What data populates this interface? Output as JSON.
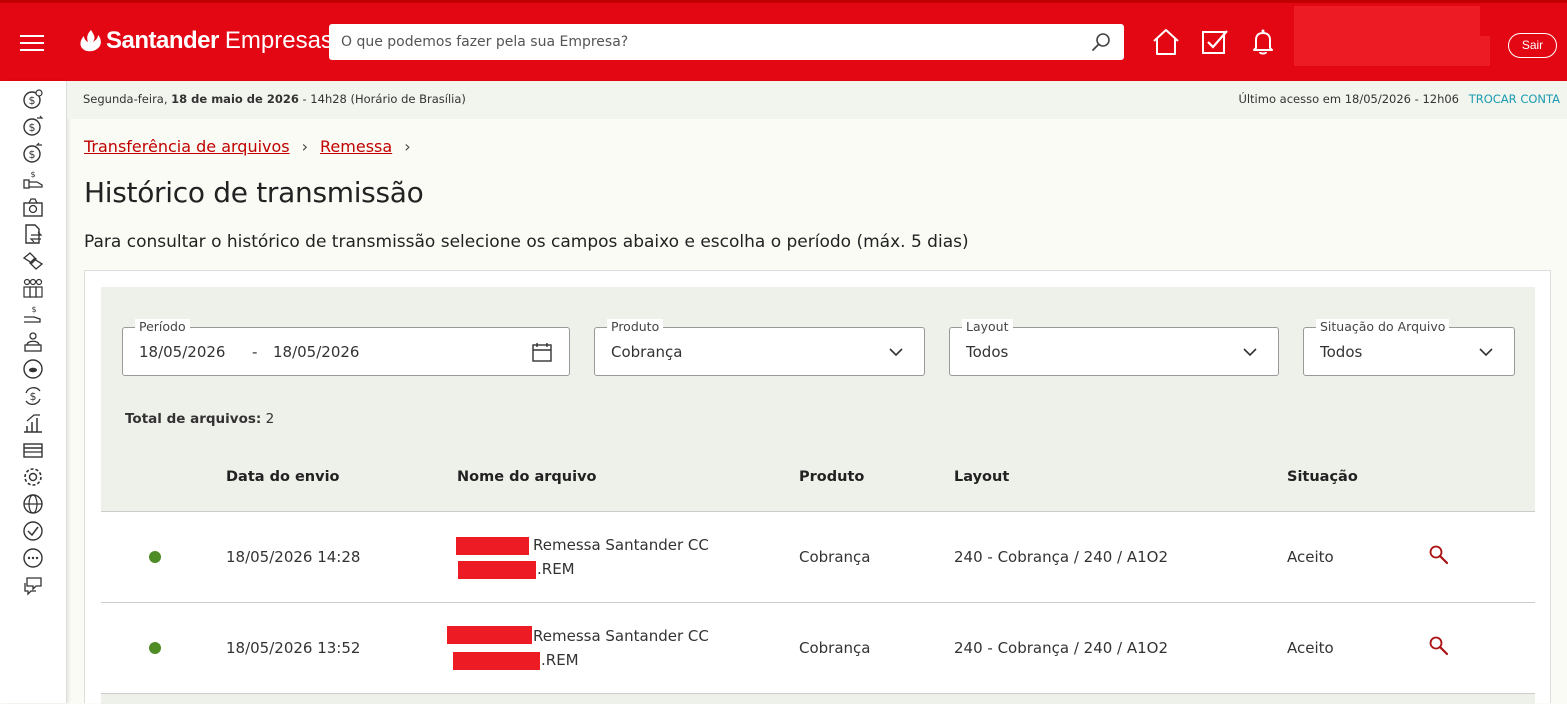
{
  "header": {
    "brand": "Santander",
    "brand_sub": "Empresas",
    "search_placeholder": "O que podemos fazer pela sua Empresa?",
    "logout_label": "Sair"
  },
  "info": {
    "date_prefix": "Segunda-feira, ",
    "date_bold": "18 de maio de 2026",
    "date_suffix": " - 14h28 (Horário de Brasília)",
    "last_access": "Último acesso em  18/05/2026 - 12h06",
    "switch_account": "TROCAR CONTA"
  },
  "breadcrumb": [
    "Transferência de arquivos",
    "Remessa"
  ],
  "page": {
    "title": "Histórico de transmissão",
    "description": "Para consultar o histórico de transmissão selecione os campos abaixo e escolha o período (máx. 5 dias)"
  },
  "filters": {
    "period_label": "Período",
    "period_start": "18/05/2026",
    "period_sep": "-",
    "period_end": "18/05/2026",
    "product_label": "Produto",
    "product_value": "Cobrança",
    "layout_label": "Layout",
    "layout_value": "Todos",
    "status_label": "Situação do Arquivo",
    "status_value": "Todos"
  },
  "total": {
    "label": "Total de arquivos:",
    "value": "2"
  },
  "table": {
    "headers": [
      "Data do envio",
      "Nome do arquivo",
      "Produto",
      "Layout",
      "Situação"
    ],
    "rows": [
      {
        "date": "18/05/2026 14:28",
        "name_line1": "Remessa Santander CC",
        "name_line2": ".REM",
        "product": "Cobrança",
        "layout": "240 - Cobrança / 240 / A1O2",
        "status": "Aceito"
      },
      {
        "date": "18/05/2026 13:52",
        "name_line1": "Remessa Santander CC",
        "name_line2": ".REM",
        "product": "Cobrança",
        "layout": "240 - Cobrança / 240 / A1O2",
        "status": "Aceito"
      }
    ]
  },
  "icons": {
    "rail": [
      "dollar-search-icon",
      "dollar-transfer-icon",
      "dollar-exchange-icon",
      "payment-hand-icon",
      "camera-icon",
      "document-transfer-icon",
      "handshake-icon",
      "team-icon",
      "dollar-hand-icon",
      "investor-icon",
      "savings-icon",
      "currency-exchange-icon",
      "growth-icon",
      "card-stack-icon",
      "gear-icon",
      "globe-icon",
      "check-circle-icon",
      "more-icon",
      "chat-icon"
    ]
  },
  "colors": {
    "brand_red": "#e30613",
    "link_red": "#c00000",
    "accent_teal": "#1a9bb0",
    "status_green": "#508c25"
  }
}
